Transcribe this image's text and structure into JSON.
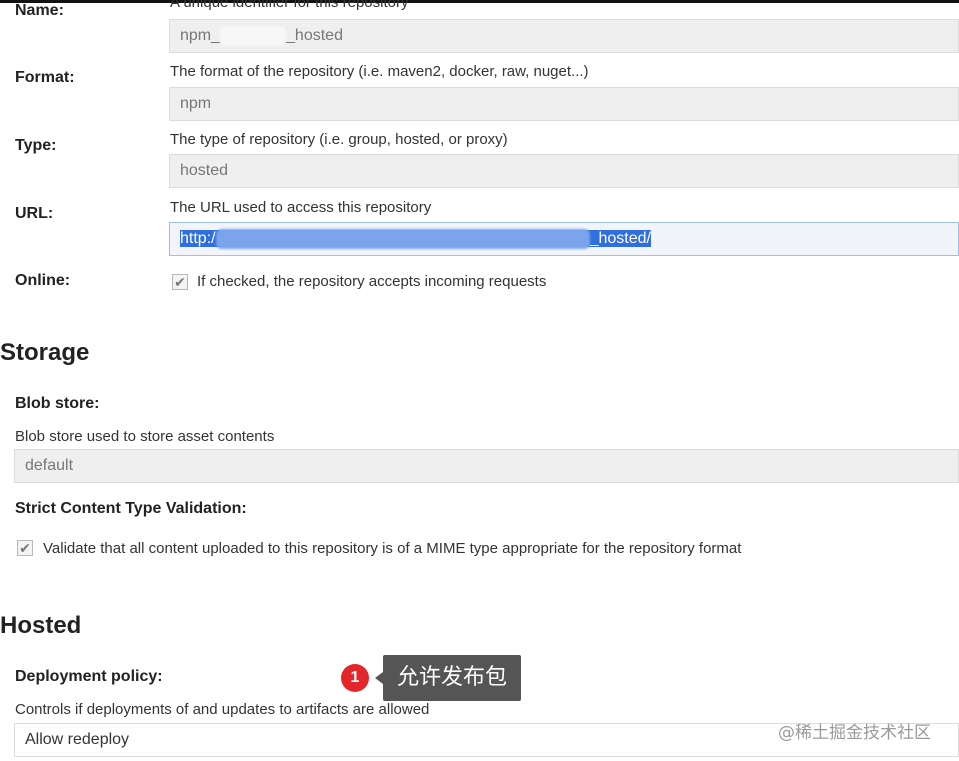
{
  "repository": {
    "name_label": "Name:",
    "name_desc": "A unique identifier for this repository",
    "name_prefix": "npm_",
    "name_suffix": "_hosted",
    "format_label": "Format:",
    "format_desc": "The format of the repository (i.e. maven2, docker, raw, nuget...)",
    "format_value": "npm",
    "type_label": "Type:",
    "type_desc": "The type of repository (i.e. group, hosted, or proxy)",
    "type_value": "hosted",
    "url_label": "URL:",
    "url_desc": "The URL used to access this repository",
    "url_prefix": "http:/",
    "url_suffix": "_hosted/",
    "online_label": "Online:",
    "online_desc": "If checked, the repository accepts incoming requests",
    "online_checked": true
  },
  "storage": {
    "title": "Storage",
    "blob_label": "Blob store:",
    "blob_desc": "Blob store used to store asset contents",
    "blob_value": "default",
    "strict_label": "Strict Content Type Validation:",
    "strict_desc": "Validate that all content uploaded to this repository is of a MIME type appropriate for the repository format",
    "strict_checked": true
  },
  "hosted": {
    "title": "Hosted",
    "policy_label": "Deployment policy:",
    "policy_desc": "Controls if deployments of and updates to artifacts are allowed",
    "policy_value": "Allow redeploy"
  },
  "annotation": {
    "badge": "1",
    "tooltip": "允许发布包"
  },
  "watermark": "@稀土掘金技术社区",
  "check_glyph": "✔"
}
